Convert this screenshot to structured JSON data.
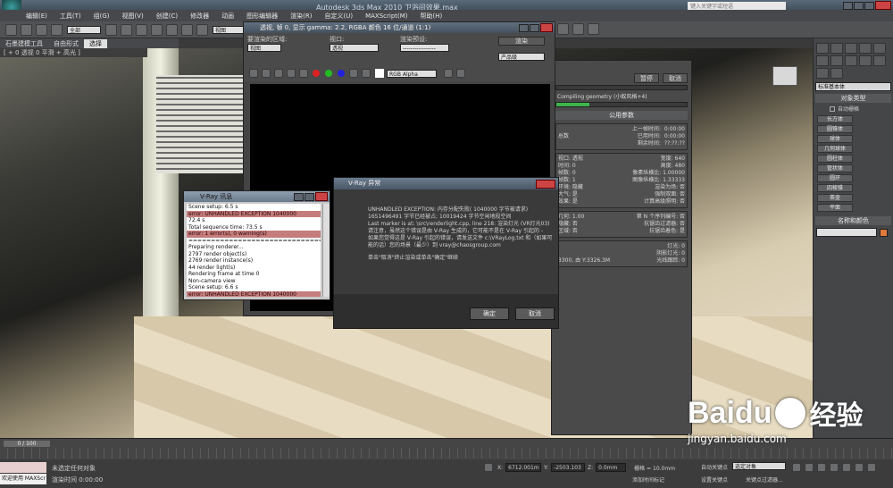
{
  "window": {
    "title": "Autodesk 3ds Max  2010     卫浴间效果.max",
    "search_placeholder": "键入关键字或短语"
  },
  "menu": [
    "编辑(E)",
    "工具(T)",
    "组(G)",
    "视图(V)",
    "创建(C)",
    "修改器",
    "动画",
    "图形编辑器",
    "渲染(R)",
    "自定义(U)",
    "MAXScript(M)",
    "帮助(H)"
  ],
  "toolbar": {
    "selection_filter": "全部",
    "coord_system": "视图"
  },
  "ribbon": [
    "石墨建模工具",
    "自由形式",
    "选择"
  ],
  "viewport": {
    "label": "[ + 0 透视 0 平滑 + 高光 ]"
  },
  "command_panel": {
    "dropdown": "标准基本体",
    "object_type_title": "对象类型",
    "auto_grid": "自动栅格",
    "buttons": [
      "长方体",
      "圆锥体",
      "球体",
      "几何球体",
      "圆柱体",
      "管状体",
      "圆环",
      "四棱锥",
      "茶壶",
      "平面"
    ],
    "name_color_title": "名称和颜色"
  },
  "frame_window": {
    "title": "透视, 帧 0, 显示 gamma: 2.2, RGBA 颜色 16 位/通道 (1:1)",
    "area_label": "要渲染的区域:",
    "area_value": "视图",
    "viewport_label": "视口:",
    "viewport_value": "透视",
    "preset_label": "渲染预设:",
    "preset_value": "-----------------",
    "render_button": "渲染",
    "product_value": "产品级",
    "channel_value": "RGB Alpha"
  },
  "progress_window": {
    "pause": "暂停",
    "cancel": "取消",
    "status": "Compiling geometry (小蚁风格+4)",
    "common_params": "公用参数",
    "time_rows": [
      [
        "上一帧时间:",
        "0:00:00"
      ],
      [
        "总数",
        "已用时间:",
        "0:00:00"
      ],
      [
        "剩余时间:",
        "??:??:??"
      ]
    ],
    "rows": [
      [
        "视口: 透视",
        "宽度: 640"
      ],
      [
        "时间: 0",
        "高度: 480"
      ],
      [
        "帧数: 0",
        "像素纵横比: 1.00000"
      ],
      [
        "帧数: 1",
        "图像纵横比: 1.33333"
      ],
      [
        "环境: 隐藏",
        "渲染为场: 否"
      ],
      [
        "大气: 是",
        "强制双面: 否"
      ],
      [
        "效果: 是",
        "计算高级照明: 否"
      ]
    ],
    "rows2": [
      [
        "几何: 1.00",
        "第 N 个序列编号: 否"
      ],
      [
        "隐藏: 否",
        "抗锯齿过滤器: 否"
      ],
      [
        "区域: 否",
        "抗锯齿着色: 是"
      ]
    ],
    "rows3": [
      [
        "",
        "灯光: 0"
      ],
      [
        "",
        "阴影灯光: 0"
      ],
      [
        "3300, 由 Y:3326.3M",
        "光线跟踪: 0"
      ]
    ]
  },
  "messages_window": {
    "title": "V-Ray 讯息",
    "lines": [
      {
        "t": "Scene setup: 6.5 s",
        "e": false
      },
      {
        "t": "error: UNHANDLED EXCEPTION          1040000",
        "e": true
      },
      {
        "t": "    72.4 s",
        "e": false
      },
      {
        "t": "Total sequence time: 73.5 s",
        "e": false
      },
      {
        "t": "error: 1 error(s), 0 warning(s)",
        "e": true
      },
      {
        "t": "==============================",
        "e": false
      },
      {
        "t": "Preparing renderer...",
        "e": false
      },
      {
        "t": "2797 render object(s)",
        "e": false
      },
      {
        "t": "2769 render instance(s)",
        "e": false
      },
      {
        "t": "44 render light(s)",
        "e": false
      },
      {
        "t": "Rendering frame at time 0",
        "e": false
      },
      {
        "t": "Non-camera view",
        "e": false
      },
      {
        "t": "Scene setup: 6.6 s",
        "e": false
      },
      {
        "t": "error: UNHANDLED EXCEPTION          1040000",
        "e": true
      }
    ]
  },
  "dialog": {
    "title": "V-Ray 异常",
    "lines": [
      "UNHANDLED EXCEPTION: 内存分配失败( 1040000 字节被请求)",
      "1651496491 字节已经被占; 10019424 字节空闲地段空间",
      "Last marker is at: \\src\\renderlight.cpp, line 218: 渲染灯光 (VR灯光03)",
      "请注意，虽然这个错误是由 V-Ray 生成的，它可能不是在 V-Ray 引起的 -",
      "如果您觉得这是 V-Ray 引起的错误，请发送文件 c:\\VRayLog.txt 和（如果可能的话）您的场景（最少）到 vray@chaosgroup.com",
      "",
      "单击\"取消\"终止渲染或单击\"确定\"继续"
    ],
    "ok": "确定",
    "cancel": "取消"
  },
  "timeline": {
    "frame": "0 / 100"
  },
  "status": {
    "selected": "未选定任何对象",
    "render_time": "渲染时间  0:00:00",
    "welcome": "欢迎使用 MAXScr",
    "x": "6712.001m",
    "y": "-2503.103",
    "z": "0.0mm",
    "grid": "栅格 = 10.0mm",
    "auto_key": "自动关键点",
    "set_key": "设置关键点",
    "selection": "选定对象",
    "key_filter": "关键点过滤器...",
    "add_tag": "添加时间标记"
  },
  "watermark": {
    "brand": "Baidu",
    "text": "经验",
    "url": "jingyan.baidu.com"
  }
}
